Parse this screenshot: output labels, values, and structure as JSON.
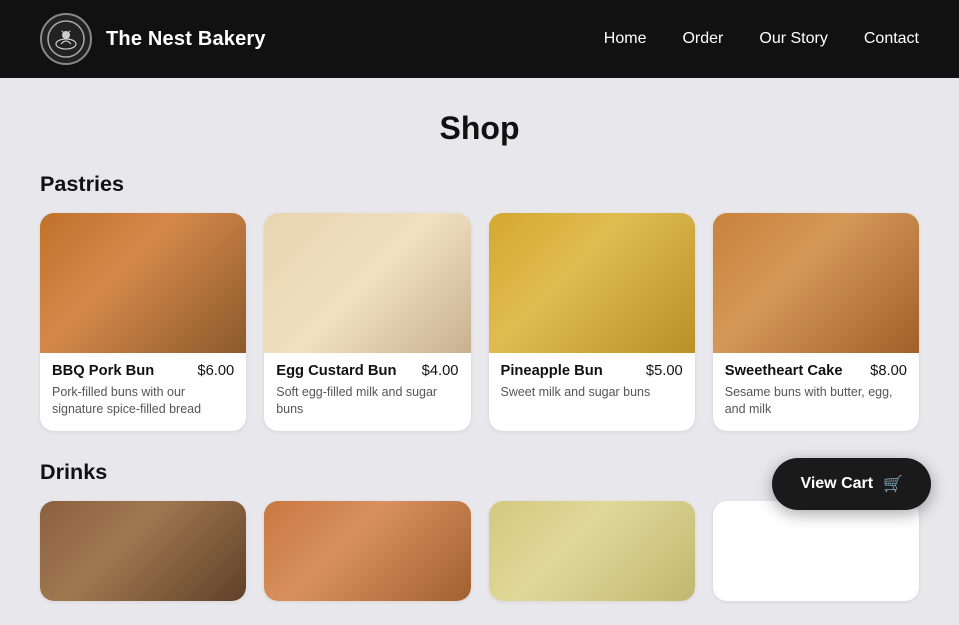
{
  "header": {
    "brand": "The Nest Bakery",
    "nav": [
      {
        "label": "Home",
        "href": "#"
      },
      {
        "label": "Order",
        "href": "#"
      },
      {
        "label": "Our Story",
        "href": "#"
      },
      {
        "label": "Contact",
        "href": "#"
      }
    ]
  },
  "page": {
    "title": "Shop"
  },
  "sections": {
    "pastries": {
      "title": "Pastries",
      "products": [
        {
          "name": "BBQ Pork Bun",
          "price": "$6.00",
          "desc": "Pork-filled buns with our signature spice-filled bread",
          "img_class": "img-bbq"
        },
        {
          "name": "Egg Custard Bun",
          "price": "$4.00",
          "desc": "Soft egg-filled milk and sugar buns",
          "img_class": "img-egg"
        },
        {
          "name": "Pineapple Bun",
          "price": "$5.00",
          "desc": "Sweet milk and sugar buns",
          "img_class": "img-pineapple"
        },
        {
          "name": "Sweetheart Cake",
          "price": "$8.00",
          "desc": "Sesame buns with butter, egg, and milk",
          "img_class": "img-sweetheart"
        }
      ]
    },
    "drinks": {
      "title": "Drinks",
      "products": [
        {
          "name": "",
          "price": "",
          "desc": "",
          "img_class": "img-drink1"
        },
        {
          "name": "",
          "price": "",
          "desc": "",
          "img_class": "img-drink2"
        },
        {
          "name": "",
          "price": "",
          "desc": "",
          "img_class": "img-drink3"
        },
        {
          "name": "",
          "price": "",
          "desc": "",
          "img_class": "img-drink4"
        }
      ]
    }
  },
  "cart": {
    "button_label": "View Cart",
    "icon": "🛒"
  }
}
